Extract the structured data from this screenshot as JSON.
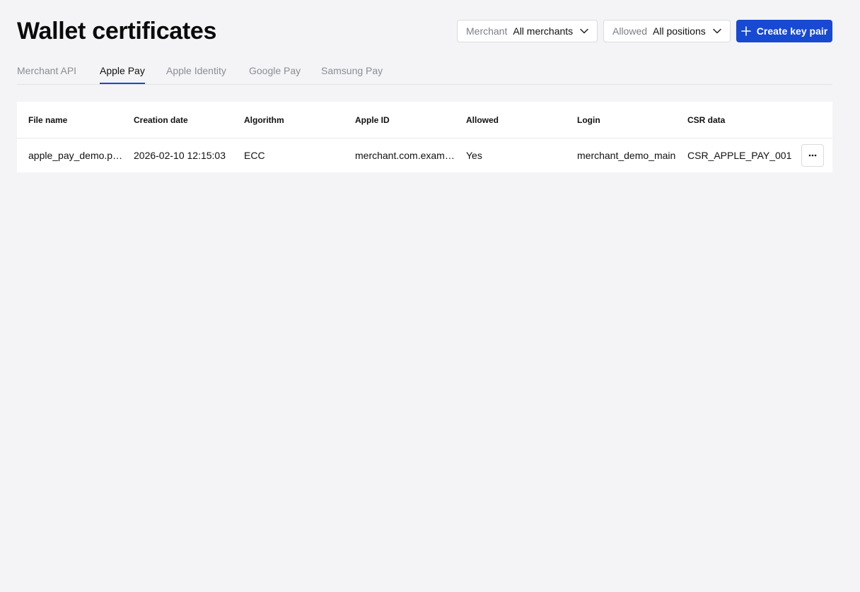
{
  "header": {
    "title": "Wallet certificates",
    "merchant_filter": {
      "label": "Merchant",
      "value": "All merchants",
      "icon": "chevron-down-icon"
    },
    "allowed_filter": {
      "label": "Allowed",
      "value": "All positions",
      "icon": "chevron-down-icon"
    },
    "create_button": {
      "label": "Create key pair",
      "icon": "plus-icon"
    }
  },
  "tabs": [
    {
      "label": "Merchant API",
      "active": false
    },
    {
      "label": "Apple Pay",
      "active": true
    },
    {
      "label": "Apple Identity",
      "active": false
    },
    {
      "label": "Google Pay",
      "active": false
    },
    {
      "label": "Samsung Pay",
      "active": false
    }
  ],
  "table": {
    "columns": [
      "File name",
      "Creation date",
      "Algorithm",
      "Apple ID",
      "Allowed",
      "Login",
      "CSR data"
    ],
    "rows": [
      {
        "file_name": "apple_pay_demo.pem",
        "creation_date": "2026-02-10 12:15:03",
        "algorithm": "ECC",
        "apple_id": "merchant.com.example",
        "allowed": "Yes",
        "login": "merchant_demo_main",
        "csr_data": "CSR_APPLE_PAY_001",
        "actions_icon": "more-horizontal-icon"
      }
    ]
  },
  "colors": {
    "background": "#f4f4f6",
    "accent": "#1749d2",
    "border": "#d9dbe0",
    "muted_text": "#8a8d93"
  }
}
